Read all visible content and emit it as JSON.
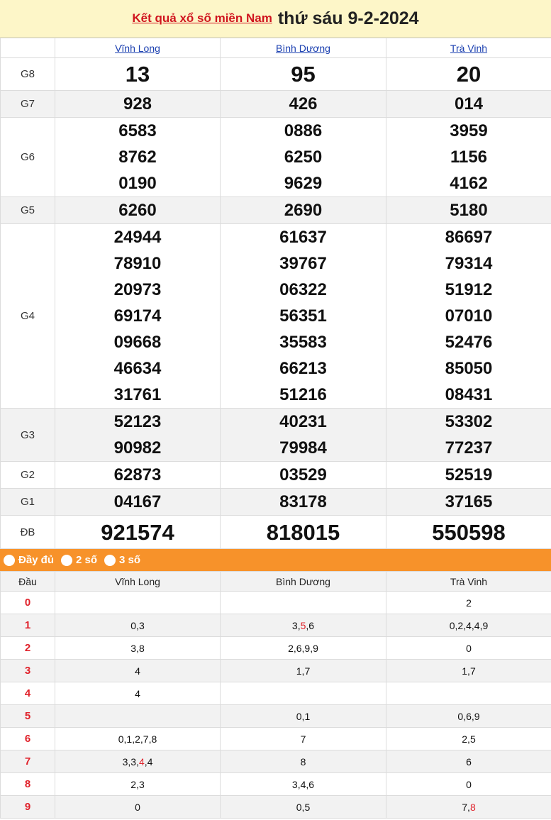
{
  "header": {
    "link_text": "Kết quả xổ số miền Nam",
    "date_text": "thứ sáu 9-2-2024"
  },
  "provinces": [
    "Vĩnh Long",
    "Bình Dương",
    "Trà Vinh"
  ],
  "prizes": {
    "G8": {
      "label": "G8",
      "values": [
        [
          "13"
        ],
        [
          "95"
        ],
        [
          "20"
        ]
      ]
    },
    "G7": {
      "label": "G7",
      "values": [
        [
          "928"
        ],
        [
          "426"
        ],
        [
          "014"
        ]
      ]
    },
    "G6": {
      "label": "G6",
      "values": [
        [
          "6583",
          "8762",
          "0190"
        ],
        [
          "0886",
          "6250",
          "9629"
        ],
        [
          "3959",
          "1156",
          "4162"
        ]
      ]
    },
    "G5": {
      "label": "G5",
      "values": [
        [
          "6260"
        ],
        [
          "2690"
        ],
        [
          "5180"
        ]
      ]
    },
    "G4": {
      "label": "G4",
      "values": [
        [
          "24944",
          "78910",
          "20973",
          "69174",
          "09668",
          "46634",
          "31761"
        ],
        [
          "61637",
          "39767",
          "06322",
          "56351",
          "35583",
          "66213",
          "51216"
        ],
        [
          "86697",
          "79314",
          "51912",
          "07010",
          "52476",
          "85050",
          "08431"
        ]
      ]
    },
    "G3": {
      "label": "G3",
      "values": [
        [
          "52123",
          "90982"
        ],
        [
          "40231",
          "79984"
        ],
        [
          "53302",
          "77237"
        ]
      ]
    },
    "G2": {
      "label": "G2",
      "values": [
        [
          "62873"
        ],
        [
          "03529"
        ],
        [
          "52519"
        ]
      ]
    },
    "G1": {
      "label": "G1",
      "values": [
        [
          "04167"
        ],
        [
          "83178"
        ],
        [
          "37165"
        ]
      ]
    },
    "DB": {
      "label": "ĐB",
      "values": [
        [
          "921574"
        ],
        [
          "818015"
        ],
        [
          "550598"
        ]
      ]
    }
  },
  "options": [
    "Đầy đủ",
    "2 số",
    "3 số"
  ],
  "loto": {
    "head_label": "Đầu",
    "rows": [
      {
        "head": "0",
        "cells": [
          [],
          [],
          [
            {
              "t": "2"
            }
          ]
        ]
      },
      {
        "head": "1",
        "cells": [
          [
            {
              "t": "0,3"
            }
          ],
          [
            {
              "t": "3,"
            },
            {
              "t": "5",
              "hl": true
            },
            {
              "t": ",6"
            }
          ],
          [
            {
              "t": "0,2,4,4,9"
            }
          ]
        ]
      },
      {
        "head": "2",
        "cells": [
          [
            {
              "t": "3,8"
            }
          ],
          [
            {
              "t": "2,6,9,9"
            }
          ],
          [
            {
              "t": "0"
            }
          ]
        ]
      },
      {
        "head": "3",
        "cells": [
          [
            {
              "t": "4"
            }
          ],
          [
            {
              "t": "1,7"
            }
          ],
          [
            {
              "t": "1,7"
            }
          ]
        ]
      },
      {
        "head": "4",
        "cells": [
          [
            {
              "t": "4"
            }
          ],
          [],
          []
        ]
      },
      {
        "head": "5",
        "cells": [
          [],
          [
            {
              "t": "0,1"
            }
          ],
          [
            {
              "t": "0,6,9"
            }
          ]
        ]
      },
      {
        "head": "6",
        "cells": [
          [
            {
              "t": "0,1,2,7,8"
            }
          ],
          [
            {
              "t": "7"
            }
          ],
          [
            {
              "t": "2,5"
            }
          ]
        ]
      },
      {
        "head": "7",
        "cells": [
          [
            {
              "t": "3,3,"
            },
            {
              "t": "4",
              "hl": true
            },
            {
              "t": ",4"
            }
          ],
          [
            {
              "t": "8"
            }
          ],
          [
            {
              "t": "6"
            }
          ]
        ]
      },
      {
        "head": "8",
        "cells": [
          [
            {
              "t": "2,3"
            }
          ],
          [
            {
              "t": "3,4,6"
            }
          ],
          [
            {
              "t": "0"
            }
          ]
        ]
      },
      {
        "head": "9",
        "cells": [
          [
            {
              "t": "0"
            }
          ],
          [
            {
              "t": "0,5"
            }
          ],
          [
            {
              "t": "7,"
            },
            {
              "t": "8",
              "hl": true
            }
          ]
        ]
      }
    ]
  },
  "colors": {
    "accent_red": "#e0222b",
    "link_blue": "#1a3fb0",
    "orange_bar": "#f7922a",
    "header_bg": "#fdf6c8"
  }
}
